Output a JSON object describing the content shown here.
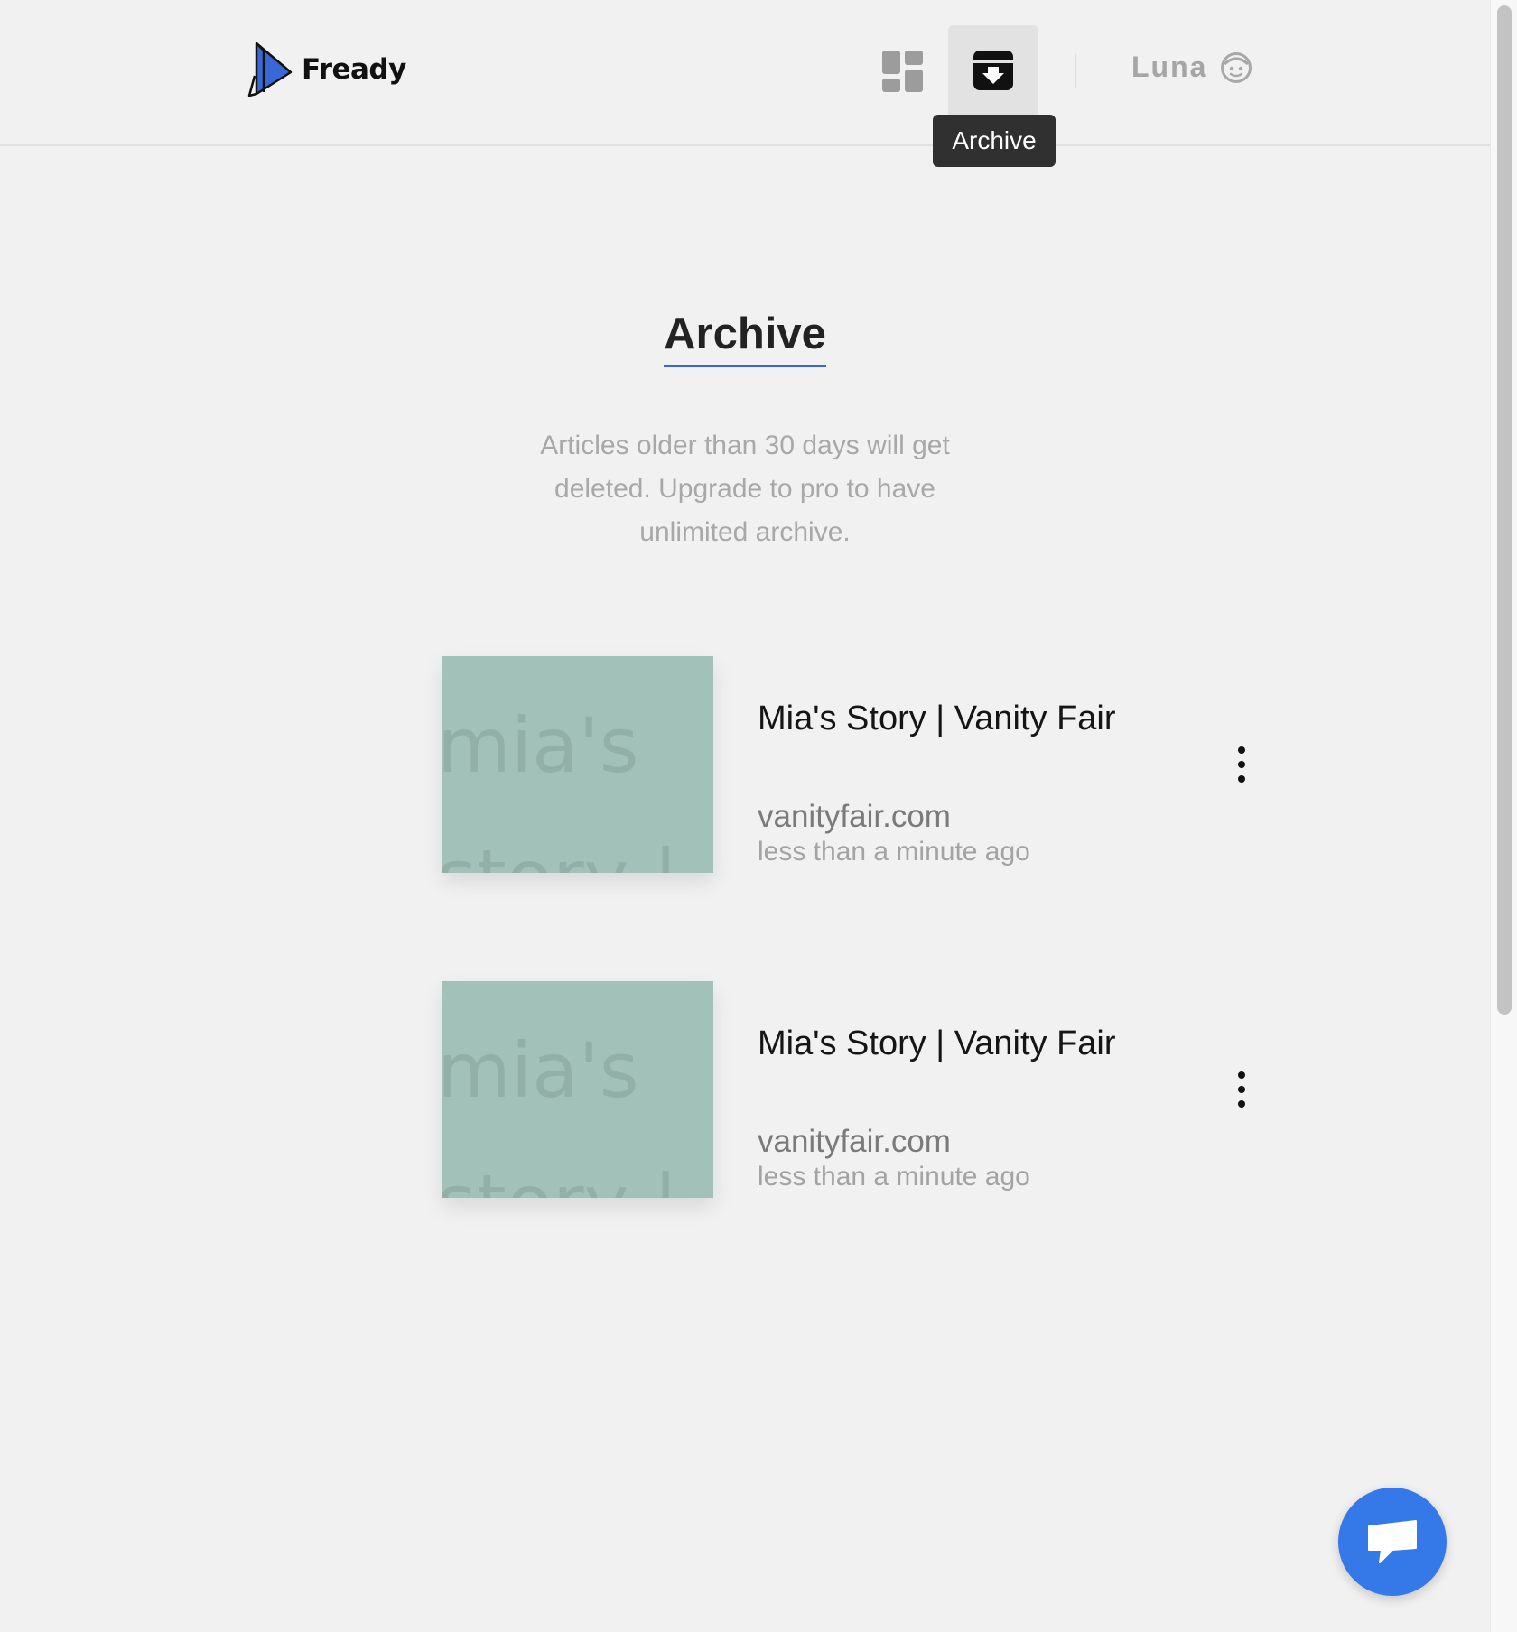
{
  "brand": {
    "name": "Fready",
    "logo_icon": "fready-logo-icon",
    "logo_color": "#3a67d8"
  },
  "nav": {
    "dashboard_icon": "dashboard-icon",
    "archive_icon": "archive-icon",
    "archive_tooltip": "Archive",
    "active_item": "archive"
  },
  "user": {
    "name": "Luna",
    "avatar_icon": "smiley-face-icon"
  },
  "page": {
    "title": "Archive",
    "notice": "Articles older than 30 days will get deleted. Upgrade to pro to have unlimited archive."
  },
  "articles": [
    {
      "thumbnail_text": "mia's\nstory |",
      "title": "Mia's Story | Vanity Fair",
      "domain": "vanityfair.com",
      "time": "less than a minute ago",
      "menu_icon": "more-vertical-icon"
    },
    {
      "thumbnail_text": "mia's\nstory |",
      "title": "Mia's Story | Vanity Fair",
      "domain": "vanityfair.com",
      "time": "less than a minute ago",
      "menu_icon": "more-vertical-icon"
    }
  ],
  "chat": {
    "icon": "chat-bubble-icon",
    "color": "#3579e8"
  },
  "colors": {
    "accent": "#3a67d8",
    "background": "#f1f1f1",
    "thumbnail": "#a2c1b9"
  }
}
